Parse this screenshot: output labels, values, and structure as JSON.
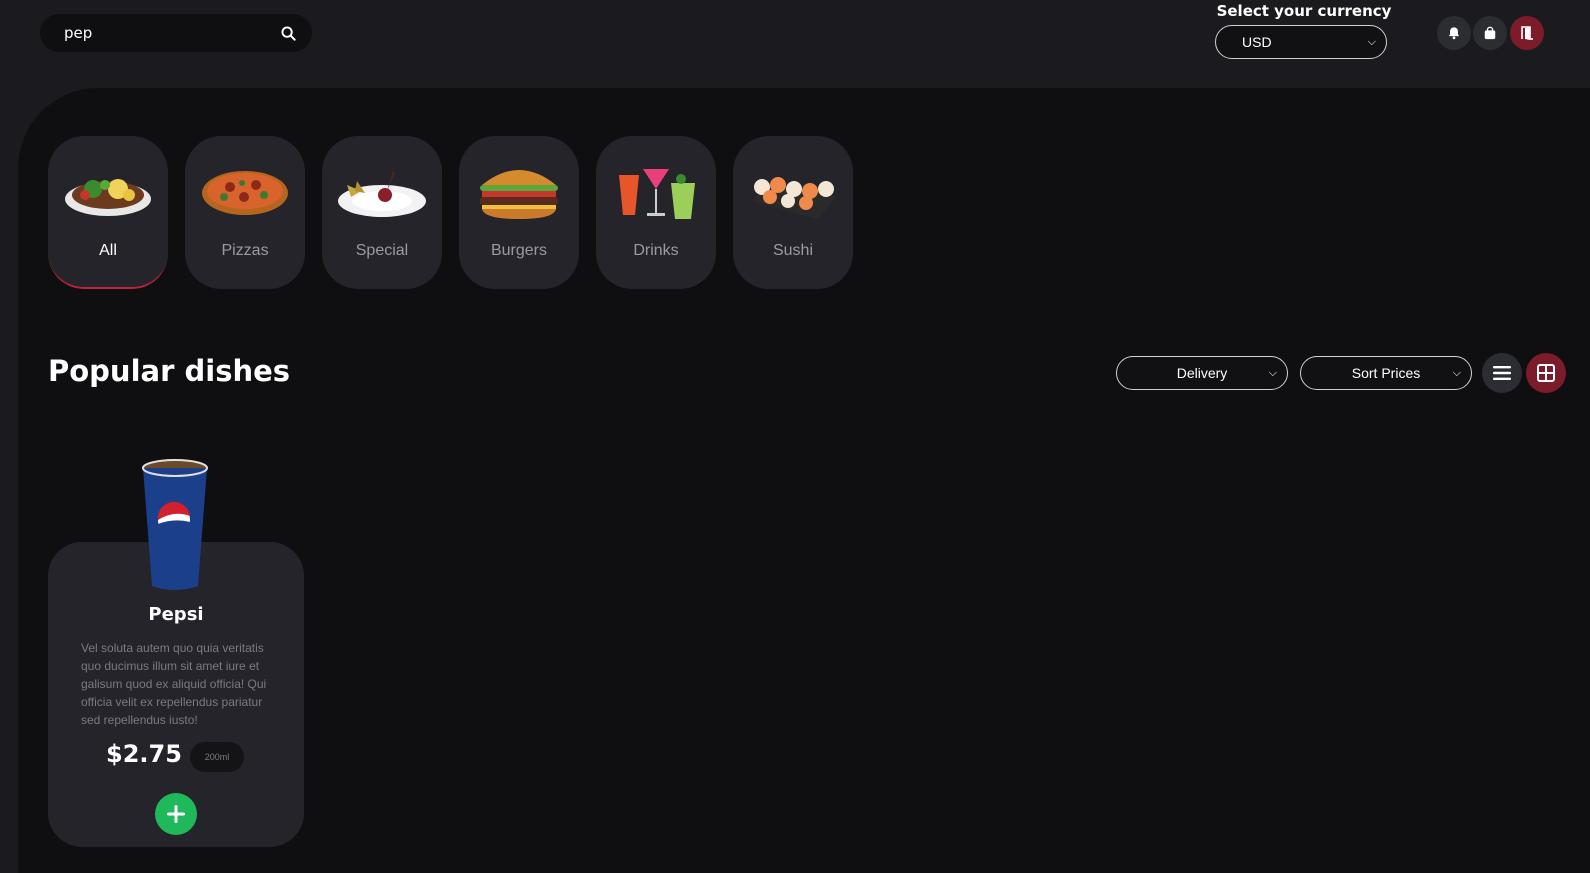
{
  "header": {
    "search": {
      "value": "pep",
      "placeholder": ""
    },
    "currency": {
      "label": "Select your currency",
      "selected": "USD"
    },
    "icons": [
      "bell-icon",
      "shopping-bag-icon",
      "logout-door-icon"
    ],
    "accent_color": "#7c1b2a"
  },
  "categories": [
    {
      "label": "All",
      "icon": "mixed-dish-icon",
      "active": true
    },
    {
      "label": "Pizzas",
      "icon": "pizza-icon",
      "active": false
    },
    {
      "label": "Special",
      "icon": "special-dish-icon",
      "active": false
    },
    {
      "label": "Burgers",
      "icon": "burger-icon",
      "active": false
    },
    {
      "label": "Drinks",
      "icon": "cocktails-icon",
      "active": false
    },
    {
      "label": "Sushi",
      "icon": "sushi-icon",
      "active": false
    }
  ],
  "section": {
    "title": "Popular dishes",
    "delivery_select": "Delivery",
    "sort_select": "Sort Prices",
    "view_modes": [
      "list-view-icon",
      "grid-view-icon"
    ],
    "active_view": "grid"
  },
  "dishes": [
    {
      "name": "Pepsi",
      "description": "Vel soluta autem quo quia veritatis quo ducimus illum sit amet iure et galisum quod ex aliquid officia! Qui officia velit ex repellendus pariatur sed repellendus iusto!",
      "price": "$2.75",
      "size": "200ml",
      "add_color": "#1fb85a"
    }
  ]
}
